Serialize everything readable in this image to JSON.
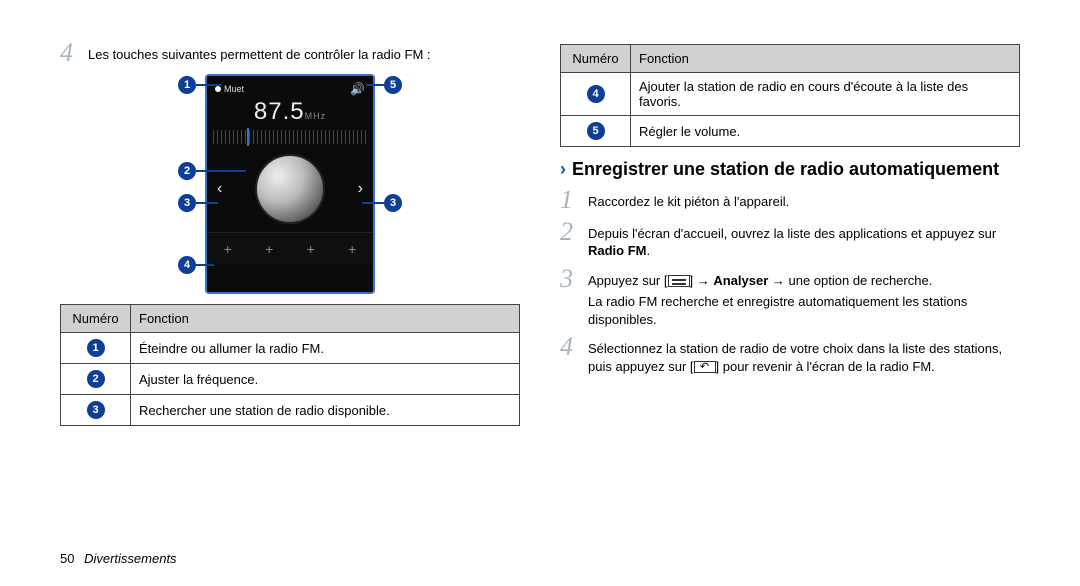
{
  "col1": {
    "step4": "Les touches suivantes permettent de contrôler la radio FM :",
    "figure": {
      "mute": "Muet",
      "freq": "87.5",
      "mhz": "MHz"
    },
    "table": {
      "h1": "Numéro",
      "h2": "Fonction",
      "rows": [
        {
          "n": "1",
          "f": "Éteindre ou allumer la radio FM."
        },
        {
          "n": "2",
          "f": "Ajuster la fréquence."
        },
        {
          "n": "3",
          "f": "Rechercher une station de radio disponible."
        }
      ]
    }
  },
  "col2": {
    "table": {
      "h1": "Numéro",
      "h2": "Fonction",
      "rows": [
        {
          "n": "4",
          "f": "Ajouter la station de radio en cours d'écoute à la liste des favoris."
        },
        {
          "n": "5",
          "f": "Régler le volume."
        }
      ]
    },
    "heading": "Enregistrer une station de radio automatiquement",
    "steps": {
      "s1": "Raccordez le kit piéton à l'appareil.",
      "s2a": "Depuis l'écran d'accueil, ouvrez la liste des applications et appuyez sur ",
      "s2b": "Radio FM",
      "s2c": ".",
      "s3a": "Appuyez sur [",
      "s3b": "] → ",
      "s3c": "Analyser",
      "s3d": " → une option de recherche.",
      "s3e": "La radio FM recherche et enregistre automatiquement les stations disponibles.",
      "s4a": "Sélectionnez la station de radio de votre choix dans la liste des stations, puis appuyez sur [",
      "s4b": "] pour revenir à l'écran de la radio FM."
    }
  },
  "footer": {
    "page": "50",
    "section": "Divertissements"
  }
}
